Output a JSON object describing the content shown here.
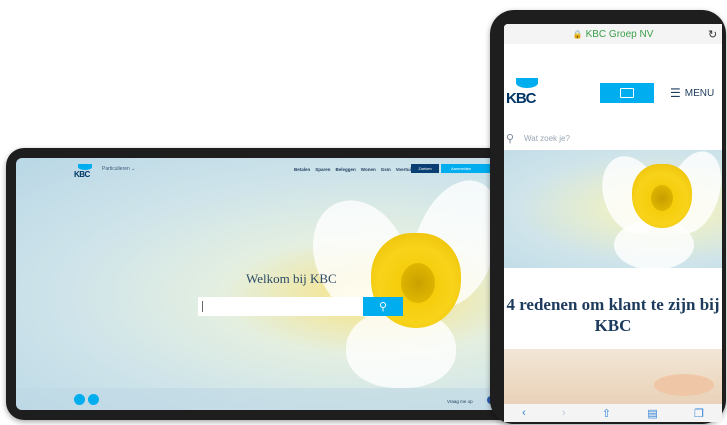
{
  "tablet": {
    "segment_label": "Particulieren",
    "nav_items": [
      "Betalen",
      "Sparen",
      "Beleggen",
      "Wonen",
      "Gsm",
      "Voertuig"
    ],
    "btn_dark_label": "Zoeken",
    "btn_light_label": "Aanmelden",
    "heading": "Welkom bij KBC",
    "search_icon": "search-icon",
    "bottom_text": "Vraag me op"
  },
  "phone": {
    "url": "KBC Groep NV",
    "menu_label": "MENU",
    "search_placeholder": "Wat zoek je?",
    "reasons_heading": "4 redenen om klant te zijn bij KBC",
    "toolbar_icons": [
      "back-icon",
      "forward-icon",
      "share-icon",
      "bookmarks-icon",
      "tabs-icon"
    ]
  },
  "brand": {
    "logo_text": "KBC",
    "accent": "#00aeef",
    "navy": "#003665"
  }
}
